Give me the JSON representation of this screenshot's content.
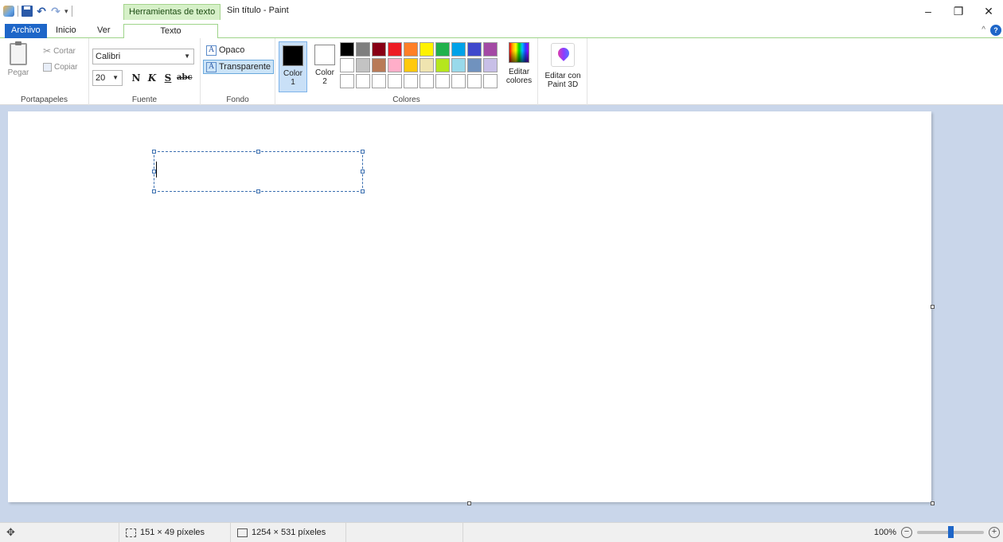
{
  "title_bar": {
    "context_tab": "Herramientas de texto",
    "document_title": "Sin título - Paint",
    "minimize": "–",
    "restore": "❐",
    "close": "✕"
  },
  "tabs": {
    "file": "Archivo",
    "home": "Inicio",
    "view": "Ver",
    "text": "Texto",
    "collapse": "^",
    "help": "?"
  },
  "ribbon": {
    "clipboard": {
      "label": "Portapapeles",
      "paste": "Pegar",
      "cut": "Cortar",
      "copy": "Copiar"
    },
    "font": {
      "label": "Fuente",
      "family": "Calibri",
      "size": "20",
      "bold": "N",
      "italic": "K",
      "underline": "S",
      "strikethrough": "abc"
    },
    "background": {
      "label": "Fondo",
      "opaque": "Opaco",
      "transparent": "Transparente",
      "selected": "transparent"
    },
    "colors": {
      "label": "Colores",
      "color1_label": "Color",
      "color1_num": "1",
      "color2_label": "Color",
      "color2_num": "2",
      "color1": "#000000",
      "color2": "#ffffff",
      "edit_label1": "Editar",
      "edit_label2": "colores",
      "palette": [
        "#000000",
        "#7f7f7f",
        "#880015",
        "#ed1c24",
        "#ff7f27",
        "#fff200",
        "#22b14c",
        "#00a2e8",
        "#3f48cc",
        "#a349a4",
        "#ffffff",
        "#c3c3c3",
        "#b97a57",
        "#ffaec9",
        "#ffc90e",
        "#efe4b0",
        "#b5e61d",
        "#99d9ea",
        "#7092be",
        "#c8bfe7",
        "#ffffff",
        "#ffffff",
        "#ffffff",
        "#ffffff",
        "#ffffff",
        "#ffffff",
        "#ffffff",
        "#ffffff",
        "#ffffff",
        "#ffffff"
      ]
    },
    "paint3d": {
      "line1": "Editar con",
      "line2": "Paint 3D"
    }
  },
  "status": {
    "selection_size": "151 × 49 píxeles",
    "canvas_size": "1254 × 531 píxeles",
    "zoom": "100%",
    "zoom_out": "−",
    "zoom_in": "+",
    "zoom_fraction": 0.5
  },
  "icons": [
    "paint-logo-icon",
    "save-icon",
    "undo-icon",
    "redo-icon",
    "paste-icon",
    "scissors-icon",
    "copy-icon",
    "text-bg-icon",
    "edit-colors-icon",
    "paint3d-icon",
    "move-icon",
    "selection-size-icon",
    "canvas-size-icon"
  ]
}
